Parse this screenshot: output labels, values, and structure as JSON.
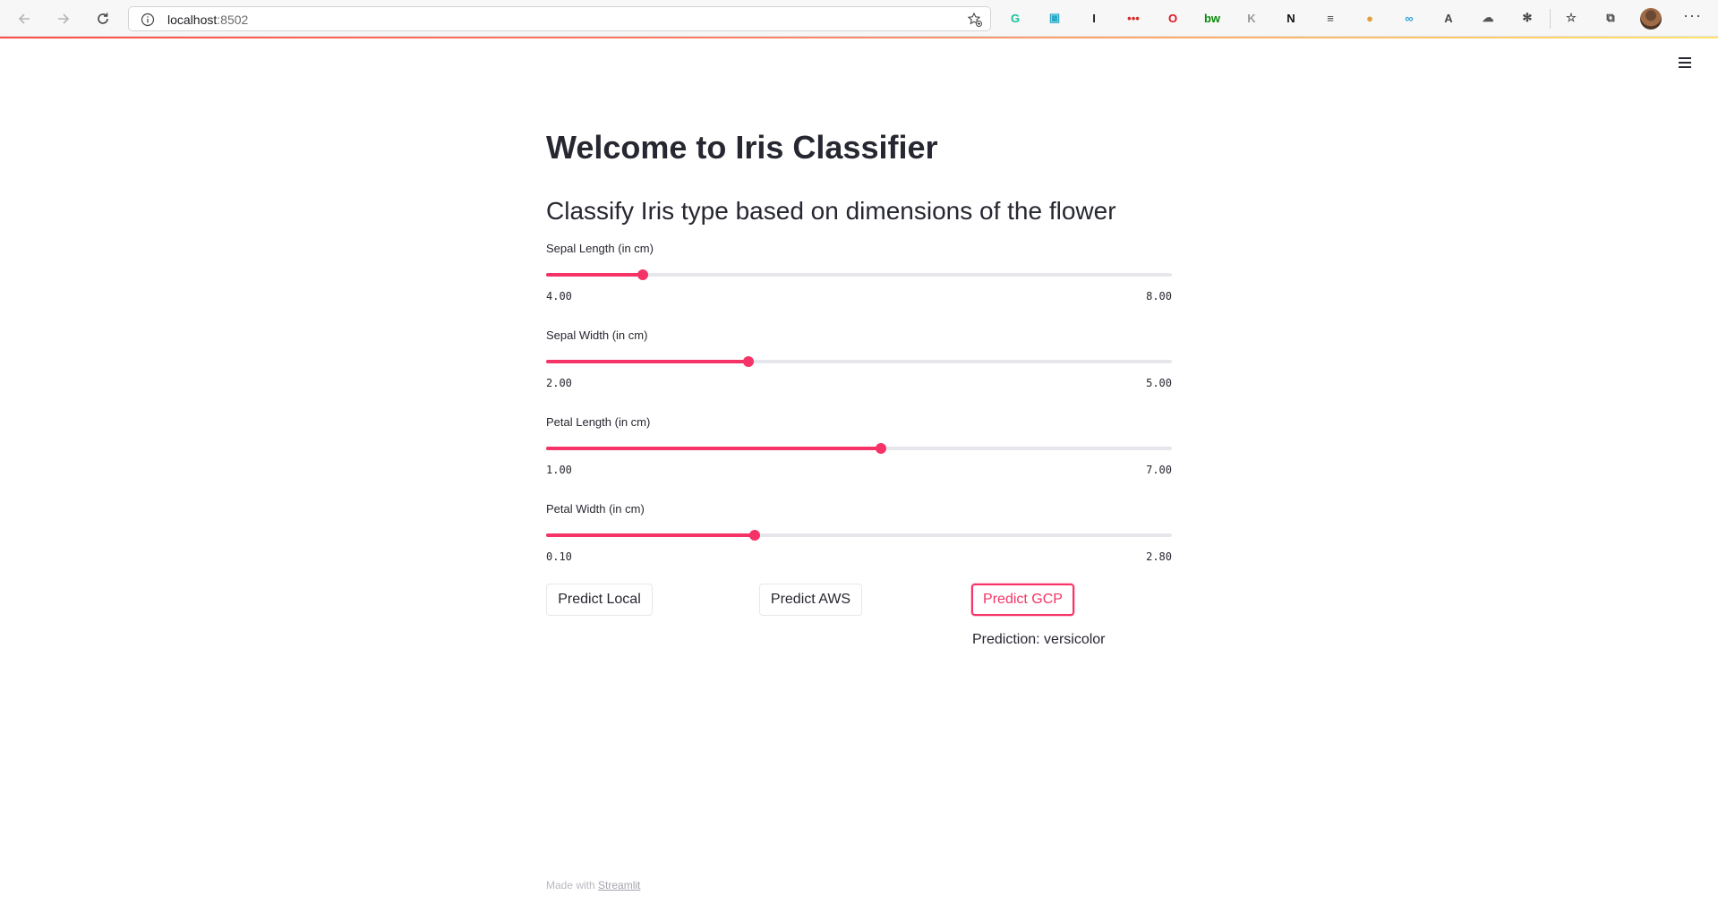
{
  "browser": {
    "url_host": "localhost",
    "url_port": ":8502",
    "extensions": [
      {
        "icon": "grammarly-icon",
        "glyph": "G",
        "color": "#15c39a"
      },
      {
        "icon": "save-icon",
        "glyph": "▣",
        "color": "#2aa9c9"
      },
      {
        "icon": "instapaper-icon",
        "glyph": "I",
        "color": "#222222"
      },
      {
        "icon": "lastpass-icon",
        "glyph": "•••",
        "color": "#d32d27"
      },
      {
        "icon": "opera-icon",
        "glyph": "O",
        "color": "#e0121d"
      },
      {
        "icon": "bw-icon",
        "glyph": "bw",
        "color": "#0a8a0a"
      },
      {
        "icon": "puzzle-gray-icon",
        "glyph": "K",
        "color": "#9a9a9a"
      },
      {
        "icon": "notion-icon",
        "glyph": "N",
        "color": "#111111"
      },
      {
        "icon": "reader-icon",
        "glyph": "≡",
        "color": "#444444"
      },
      {
        "icon": "cookie-icon",
        "glyph": "●",
        "color": "#e0a03a"
      },
      {
        "icon": "link-icon",
        "glyph": "∞",
        "color": "#2a9fd6"
      },
      {
        "icon": "read-aloud-icon",
        "glyph": "A",
        "color": "#444444"
      },
      {
        "icon": "cloud-icon",
        "glyph": "☁",
        "color": "#555555"
      },
      {
        "icon": "extensions-icon",
        "glyph": "✻",
        "color": "#444444"
      }
    ]
  },
  "app": {
    "title": "Welcome to Iris Classifier",
    "subtitle": "Classify Iris type based on dimensions of the flower",
    "sliders": [
      {
        "label": "Sepal Length (in cm)",
        "min": "4.00",
        "max": "8.00",
        "min_value": 4.0,
        "max_value": 8.0,
        "value": 4.62
      },
      {
        "label": "Sepal Width (in cm)",
        "min": "2.00",
        "max": "5.00",
        "min_value": 2.0,
        "max_value": 5.0,
        "value": 2.97
      },
      {
        "label": "Petal Length (in cm)",
        "min": "1.00",
        "max": "7.00",
        "min_value": 1.0,
        "max_value": 7.0,
        "value": 4.21
      },
      {
        "label": "Petal Width (in cm)",
        "min": "0.10",
        "max": "2.80",
        "min_value": 0.1,
        "max_value": 2.8,
        "value": 1.0
      }
    ],
    "buttons": {
      "local": "Predict Local",
      "aws": "Predict AWS",
      "gcp": "Predict GCP"
    },
    "prediction": "Prediction: versicolor",
    "footer_text": "Made with ",
    "footer_link": "Streamlit",
    "accent_color": "#f63366"
  }
}
